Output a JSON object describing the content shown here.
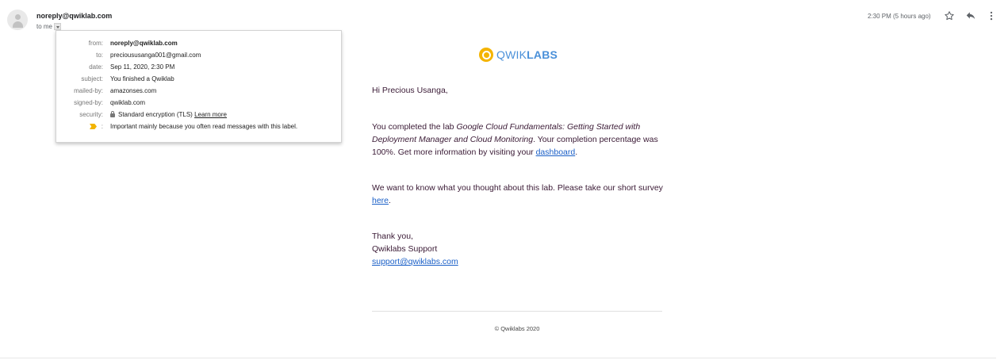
{
  "header": {
    "sender": "noreply@qwiklab.com",
    "to_label": "to me",
    "time": "2:30 PM (5 hours ago)"
  },
  "icons": {
    "avatar": "person-avatar-icon",
    "star": "star-icon",
    "reply": "reply-icon",
    "more": "more-vert-icon",
    "dropdown": "chevron-down-icon",
    "lock": "lock-icon",
    "important": "important-marker-icon"
  },
  "details": {
    "from_label": "from:",
    "from_value": "noreply@qwiklab.com",
    "to_label": "to:",
    "to_value": "precioususanga001@gmail.com",
    "date_label": "date:",
    "date_value": "Sep 11, 2020, 2:30 PM",
    "subject_label": "subject:",
    "subject_value": "You finished a Qwiklab",
    "mailedby_label": "mailed-by:",
    "mailedby_value": "amazonses.com",
    "signedby_label": "signed-by:",
    "signedby_value": "qwiklab.com",
    "security_label": "security:",
    "security_value": "Standard encryption (TLS)",
    "security_link": "Learn more",
    "important_colon": ":",
    "important_value": "Important mainly because you often read messages with this label."
  },
  "email": {
    "logo_part1": "QWIK",
    "logo_part2": "LABS",
    "greeting": "Hi Precious Usanga,",
    "p1_before": "You completed the lab ",
    "p1_lab": "Google Cloud Fundamentals: Getting Started with Deployment Manager and Cloud Monitoring",
    "p1_after": ". Your completion percentage was 100%. Get more information by visiting your ",
    "p1_link": "dashboard",
    "p1_end": ".",
    "p2_before": "We want to know what you thought about this lab. Please take our short survey ",
    "p2_link": "here",
    "p2_end": ".",
    "thanks": "Thank you,",
    "team": "Qwiklabs Support",
    "support_email": "support@qwiklabs.com",
    "copyright": "© Qwiklabs 2020"
  },
  "colors": {
    "link": "#1a5fc7",
    "logo_blue": "#4a90d9",
    "logo_yellow": "#f4b400",
    "important": "#f2b400",
    "body_text": "#3a1a35"
  }
}
